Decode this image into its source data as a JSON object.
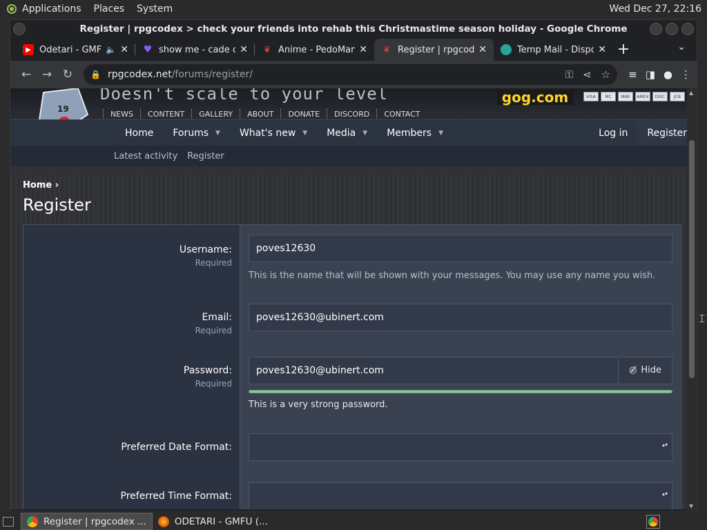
{
  "os": {
    "menu": [
      "Applications",
      "Places",
      "System"
    ],
    "clock": "Wed Dec 27, 22:16"
  },
  "window": {
    "title": "Register | rpgcodex > check your friends into rehab this Christmastime season holiday - Google Chrome"
  },
  "tabs": [
    {
      "label": "Odetari - GMF",
      "favicon": "youtube-icon",
      "color": "#ff0000",
      "audio": true
    },
    {
      "label": "show me - cade cl",
      "favicon": "heart-icon",
      "color": "#8a5cf6"
    },
    {
      "label": "Anime - PedoMan",
      "favicon": "codex-icon",
      "color": "#d04040"
    },
    {
      "label": "Register | rpgcode",
      "favicon": "codex-icon",
      "color": "#d04040",
      "active": true
    },
    {
      "label": "Temp Mail - Dispo",
      "favicon": "tempmail-icon",
      "color": "#26a69a"
    }
  ],
  "url": {
    "domain": "rpgcodex.net",
    "path": "/forums/register/"
  },
  "site": {
    "slogan": "Doesn't scale to your level",
    "gog": "gog.com",
    "cards": [
      "VISA",
      "MC",
      "MAE",
      "AMEX",
      "DISC",
      "JCB"
    ],
    "subnav": [
      "NEWS",
      "CONTENT",
      "GALLERY",
      "ABOUT",
      "DONATE",
      "DISCORD",
      "CONTACT"
    ],
    "mainnav": [
      {
        "label": "Home",
        "caret": false
      },
      {
        "label": "Forums",
        "caret": true
      },
      {
        "label": "What's new",
        "caret": true
      },
      {
        "label": "Media",
        "caret": true
      },
      {
        "label": "Members",
        "caret": true
      }
    ],
    "login": "Log in",
    "register": "Register",
    "secnav": [
      "Latest activity",
      "Register"
    ]
  },
  "breadcrumb": "Home",
  "page_title": "Register",
  "form": {
    "username": {
      "label": "Username:",
      "required": "Required",
      "value": "poves12630",
      "hint": "This is the name that will be shown with your messages. You may use any name you wish."
    },
    "email": {
      "label": "Email:",
      "required": "Required",
      "value": "poves12630@ubinert.com"
    },
    "password": {
      "label": "Password:",
      "required": "Required",
      "value": "poves12630@ubinert.com",
      "hide_label": "Hide",
      "strength_text": "This is a very strong password.",
      "strength": 1.0
    },
    "date_format": {
      "label": "Preferred Date Format:",
      "value": ""
    },
    "time_format": {
      "label": "Preferred Time Format:",
      "value": ""
    }
  },
  "taskbar": [
    {
      "label": "Register | rpgcodex ...",
      "icon": "chrome-icon",
      "active": true
    },
    {
      "label": "ODETARI - GMFU (...",
      "icon": "firefox-icon",
      "active": false
    }
  ]
}
